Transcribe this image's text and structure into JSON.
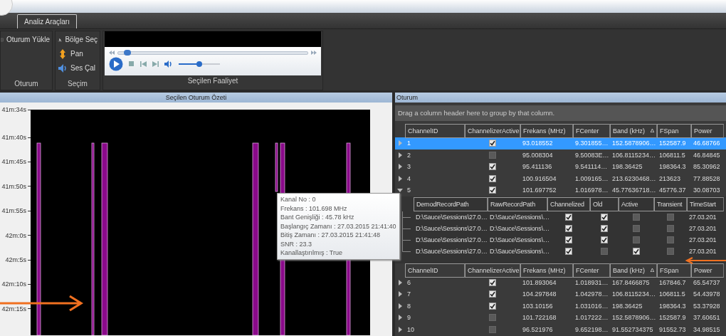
{
  "tabs": [
    {
      "label": "Analiz Araçları",
      "selected": true
    }
  ],
  "ribbon": {
    "groups": [
      {
        "title": "Oturum",
        "buttons": [
          {
            "label": "Oturum Yükle",
            "kind": "load"
          }
        ]
      },
      {
        "title": "Seçim",
        "buttons": [
          {
            "label": "Bölge Seç",
            "kind": "select"
          },
          {
            "label": "Pan",
            "kind": "pan"
          },
          {
            "label": "Ses Çal",
            "kind": "sound"
          }
        ]
      }
    ],
    "player": {
      "title": "Seçilen Faaliyet",
      "seek": {
        "level": 0.03
      },
      "volume": {
        "level": 0.5
      }
    }
  },
  "summary": {
    "title": "Seçilen Oturum Özeti",
    "time_axis": [
      "41m:34s",
      "41m:40s",
      "41m:45s",
      "41m:50s",
      "41m:55s",
      "42m:0s",
      "42m:5s",
      "42m:10s",
      "42m:15s"
    ],
    "tooltip": {
      "lines": [
        "Kanal No : 0",
        "Frekans : 101.698 MHz",
        "Bant Genişliği : 45.78 kHz",
        "Başlangıç Zamanı : 27.03.2015 21:41:40",
        "Bitiş Zamanı : 27.03.2015 21:41:48",
        "SNR : 23.3",
        "Kanallaştırılmış : True"
      ]
    }
  },
  "session": {
    "title": "Oturum",
    "group_hint": "Drag a column header here to group by that column.",
    "columns": [
      "ChannelID",
      "ChannelizerActive",
      "Frekans (MHz)",
      "FCenter",
      "Band (kHz)",
      "FSpan",
      "Power"
    ],
    "sort_column": {
      "label": "Δ"
    },
    "rows": [
      {
        "id": "1",
        "active": true,
        "frekans": "93.018552",
        "fcenter": "9.301855…",
        "band": "152.5878906…",
        "fspan": "152587.9",
        "power": "46.68766",
        "selected": true,
        "expanded": false
      },
      {
        "id": "2",
        "active": false,
        "frekans": "95.008304",
        "fcenter": "9.50083E…",
        "band": "106.8115234…",
        "fspan": "106811.5",
        "power": "46.84845",
        "selected": false,
        "expanded": false
      },
      {
        "id": "3",
        "active": true,
        "frekans": "95.411136",
        "fcenter": "9.541114…",
        "band": "198.36425",
        "fspan": "198364.3",
        "power": "85.30962",
        "selected": false,
        "expanded": false
      },
      {
        "id": "4",
        "active": true,
        "frekans": "100.916504",
        "fcenter": "1.009165…",
        "band": "213.6230468…",
        "fspan": "213623",
        "power": "77.88528",
        "selected": false,
        "expanded": false
      },
      {
        "id": "5",
        "active": true,
        "frekans": "101.697752",
        "fcenter": "1.016978…",
        "band": "45.77636718…",
        "fspan": "45776.37",
        "power": "30.08703",
        "selected": false,
        "expanded": true,
        "details": {
          "columns": [
            "DemodRecordPath",
            "RawRecordPath",
            "Channelized",
            "Old",
            "Active",
            "Transient",
            "TimeStart"
          ],
          "rows": [
            {
              "demod": "D:\\Sauce\\Sessions\\27.0…",
              "raw": "D:\\Sauce\\Sessions\\…",
              "channelized": true,
              "old": true,
              "active": false,
              "transient": false,
              "time_start": "27.03.201"
            },
            {
              "demod": "D:\\Sauce\\Sessions\\27.0…",
              "raw": "D:\\Sauce\\Sessions\\…",
              "channelized": true,
              "old": true,
              "active": false,
              "transient": false,
              "time_start": "27.03.201"
            },
            {
              "demod": "D:\\Sauce\\Sessions\\27.0…",
              "raw": "D:\\Sauce\\Sessions\\…",
              "channelized": true,
              "old": true,
              "active": false,
              "transient": false,
              "time_start": "27.03.201"
            },
            {
              "demod": "D:\\Sauce\\Sessions\\27.0…",
              "raw": "D:\\Sauce\\Sessions\\…",
              "channelized": true,
              "old": false,
              "active": true,
              "transient": false,
              "time_start": "27.03.201"
            }
          ]
        },
        "header_after": [
          "ChannelID",
          "ChannelizerActive",
          "Frekans (MHz)",
          "FCenter",
          "Band (kHz)",
          "FSpan",
          "Power"
        ],
        "header_after_sort": {
          "label": "Δ"
        }
      },
      {
        "id": "6",
        "active": true,
        "frekans": "101.893064",
        "fcenter": "1.018931…",
        "band": "167.8466875",
        "fspan": "167846.7",
        "power": "65.54737",
        "selected": false,
        "expanded": false
      },
      {
        "id": "7",
        "active": true,
        "frekans": "104.297848",
        "fcenter": "1.042978…",
        "band": "106.8115234…",
        "fspan": "106811.5",
        "power": "54.43978",
        "selected": false,
        "expanded": false
      },
      {
        "id": "8",
        "active": true,
        "frekans": "103.10156",
        "fcenter": "1.031016…",
        "band": "198.36425",
        "fspan": "198364.3",
        "power": "53.37928",
        "selected": false,
        "expanded": false
      },
      {
        "id": "9",
        "active": false,
        "frekans": "101.722168",
        "fcenter": "1.017222…",
        "band": "152.5878906…",
        "fspan": "152587.9",
        "power": "37.60651",
        "selected": false,
        "expanded": false
      },
      {
        "id": "10",
        "active": false,
        "frekans": "96.521976",
        "fcenter": "9.652198…",
        "band": "91.552734375",
        "fspan": "91552.73",
        "power": "34.98515",
        "selected": false,
        "expanded": false
      }
    ]
  },
  "annotations": [
    {
      "kind": "arrow-right"
    },
    {
      "kind": "arrow-left"
    }
  ]
}
